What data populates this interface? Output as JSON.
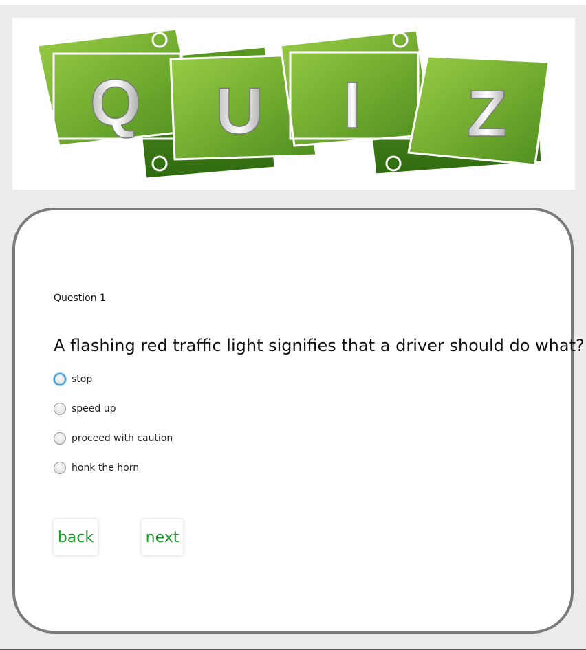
{
  "banner": {
    "letters": [
      "Q",
      "U",
      "I",
      "Z"
    ],
    "colors": {
      "green_light": "#8cc63e",
      "green_dark": "#4a8a1c",
      "frame": "#ffffff"
    }
  },
  "quiz": {
    "question_number": "Question 1",
    "question_text": "A flashing red traffic light signifies that a driver should do what?",
    "options": [
      {
        "label": "stop",
        "focused": true
      },
      {
        "label": "speed up",
        "focused": false
      },
      {
        "label": "proceed with caution",
        "focused": false
      },
      {
        "label": "honk the horn",
        "focused": false
      }
    ],
    "back_label": "back",
    "next_label": "next",
    "colors": {
      "button_text": "#1a9a2a",
      "card_border": "#7a7a7a",
      "focus_ring": "#3ba0e0"
    }
  }
}
